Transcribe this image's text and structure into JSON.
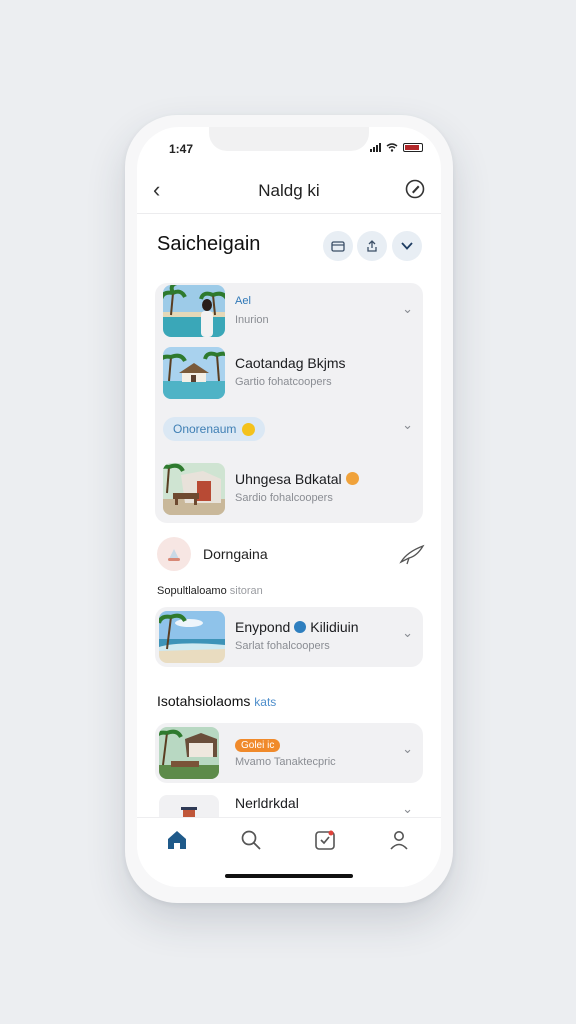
{
  "status_bar": {
    "time": "1:47"
  },
  "nav": {
    "back_label": "‹",
    "title": "Naldg ki"
  },
  "section_header": {
    "title": "Saicheigain"
  },
  "group": {
    "rows": [
      {
        "title": "Ael",
        "subtitle": "Inurion",
        "thumb": "resort-pool-portrait"
      },
      {
        "title": "Caotandag Bkjms",
        "subtitle": "Gartio fohatcoopers",
        "thumb": "villa-pool"
      },
      {
        "title": "Uhngesa Bdkatal",
        "subtitle": "Sardio fohalcoopers",
        "thumb": "bungalow-lounge"
      }
    ],
    "pill_label": "Onorenaum"
  },
  "share": {
    "label": "Dorngaina"
  },
  "meta_line": {
    "main": "Sopultlaloamo",
    "muted": "sitoran"
  },
  "featured": {
    "title_a": "Enypond",
    "title_b": "Kilidiuin",
    "subtitle": "Sarlat fohalcoopers"
  },
  "section2": {
    "main": "Isotahsiolaoms",
    "accent": "kats"
  },
  "list": [
    {
      "badge": "Golei ic",
      "subtitle": "Mvamo Tanaktecpric"
    },
    {
      "title": "Nerldrkdal",
      "subtitle": ""
    }
  ],
  "colors": {
    "accent": "#2f6ea3",
    "tab_active": "#1f5a8a",
    "badge": "#f08a2b"
  }
}
